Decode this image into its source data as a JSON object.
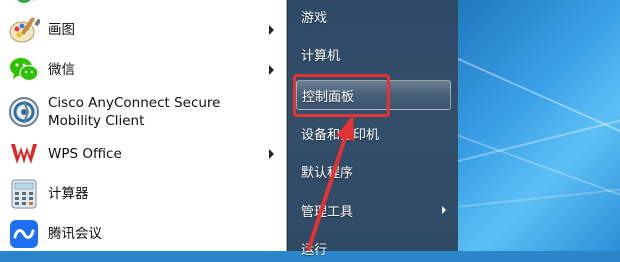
{
  "left_menu": {
    "items": [
      {
        "label": "画图",
        "icon": "paint-icon",
        "has_submenu": true
      },
      {
        "label": "微信",
        "icon": "wechat-icon",
        "has_submenu": true
      },
      {
        "label": "Cisco AnyConnect Secure Mobility Client",
        "label_line1": "Cisco AnyConnect Secure",
        "label_line2": "Mobility Client",
        "icon": "cisco-anyconnect-icon",
        "has_submenu": false
      },
      {
        "label": "WPS Office",
        "icon": "wps-office-icon",
        "has_submenu": true
      },
      {
        "label": "计算器",
        "icon": "calculator-icon",
        "has_submenu": false
      },
      {
        "label": "腾讯会议",
        "icon": "tencent-meeting-icon",
        "has_submenu": false
      }
    ]
  },
  "right_menu": {
    "items": [
      {
        "label": "游戏"
      },
      {
        "label": "计算机"
      },
      {
        "label": "控制面板",
        "highlighted": true
      },
      {
        "label": "设备和打印机"
      },
      {
        "label": "默认程序"
      },
      {
        "label": "管理工具",
        "has_submenu": true
      },
      {
        "label": "运行"
      }
    ]
  },
  "annotation": {
    "color": "#e53232",
    "target": "控制面板"
  }
}
